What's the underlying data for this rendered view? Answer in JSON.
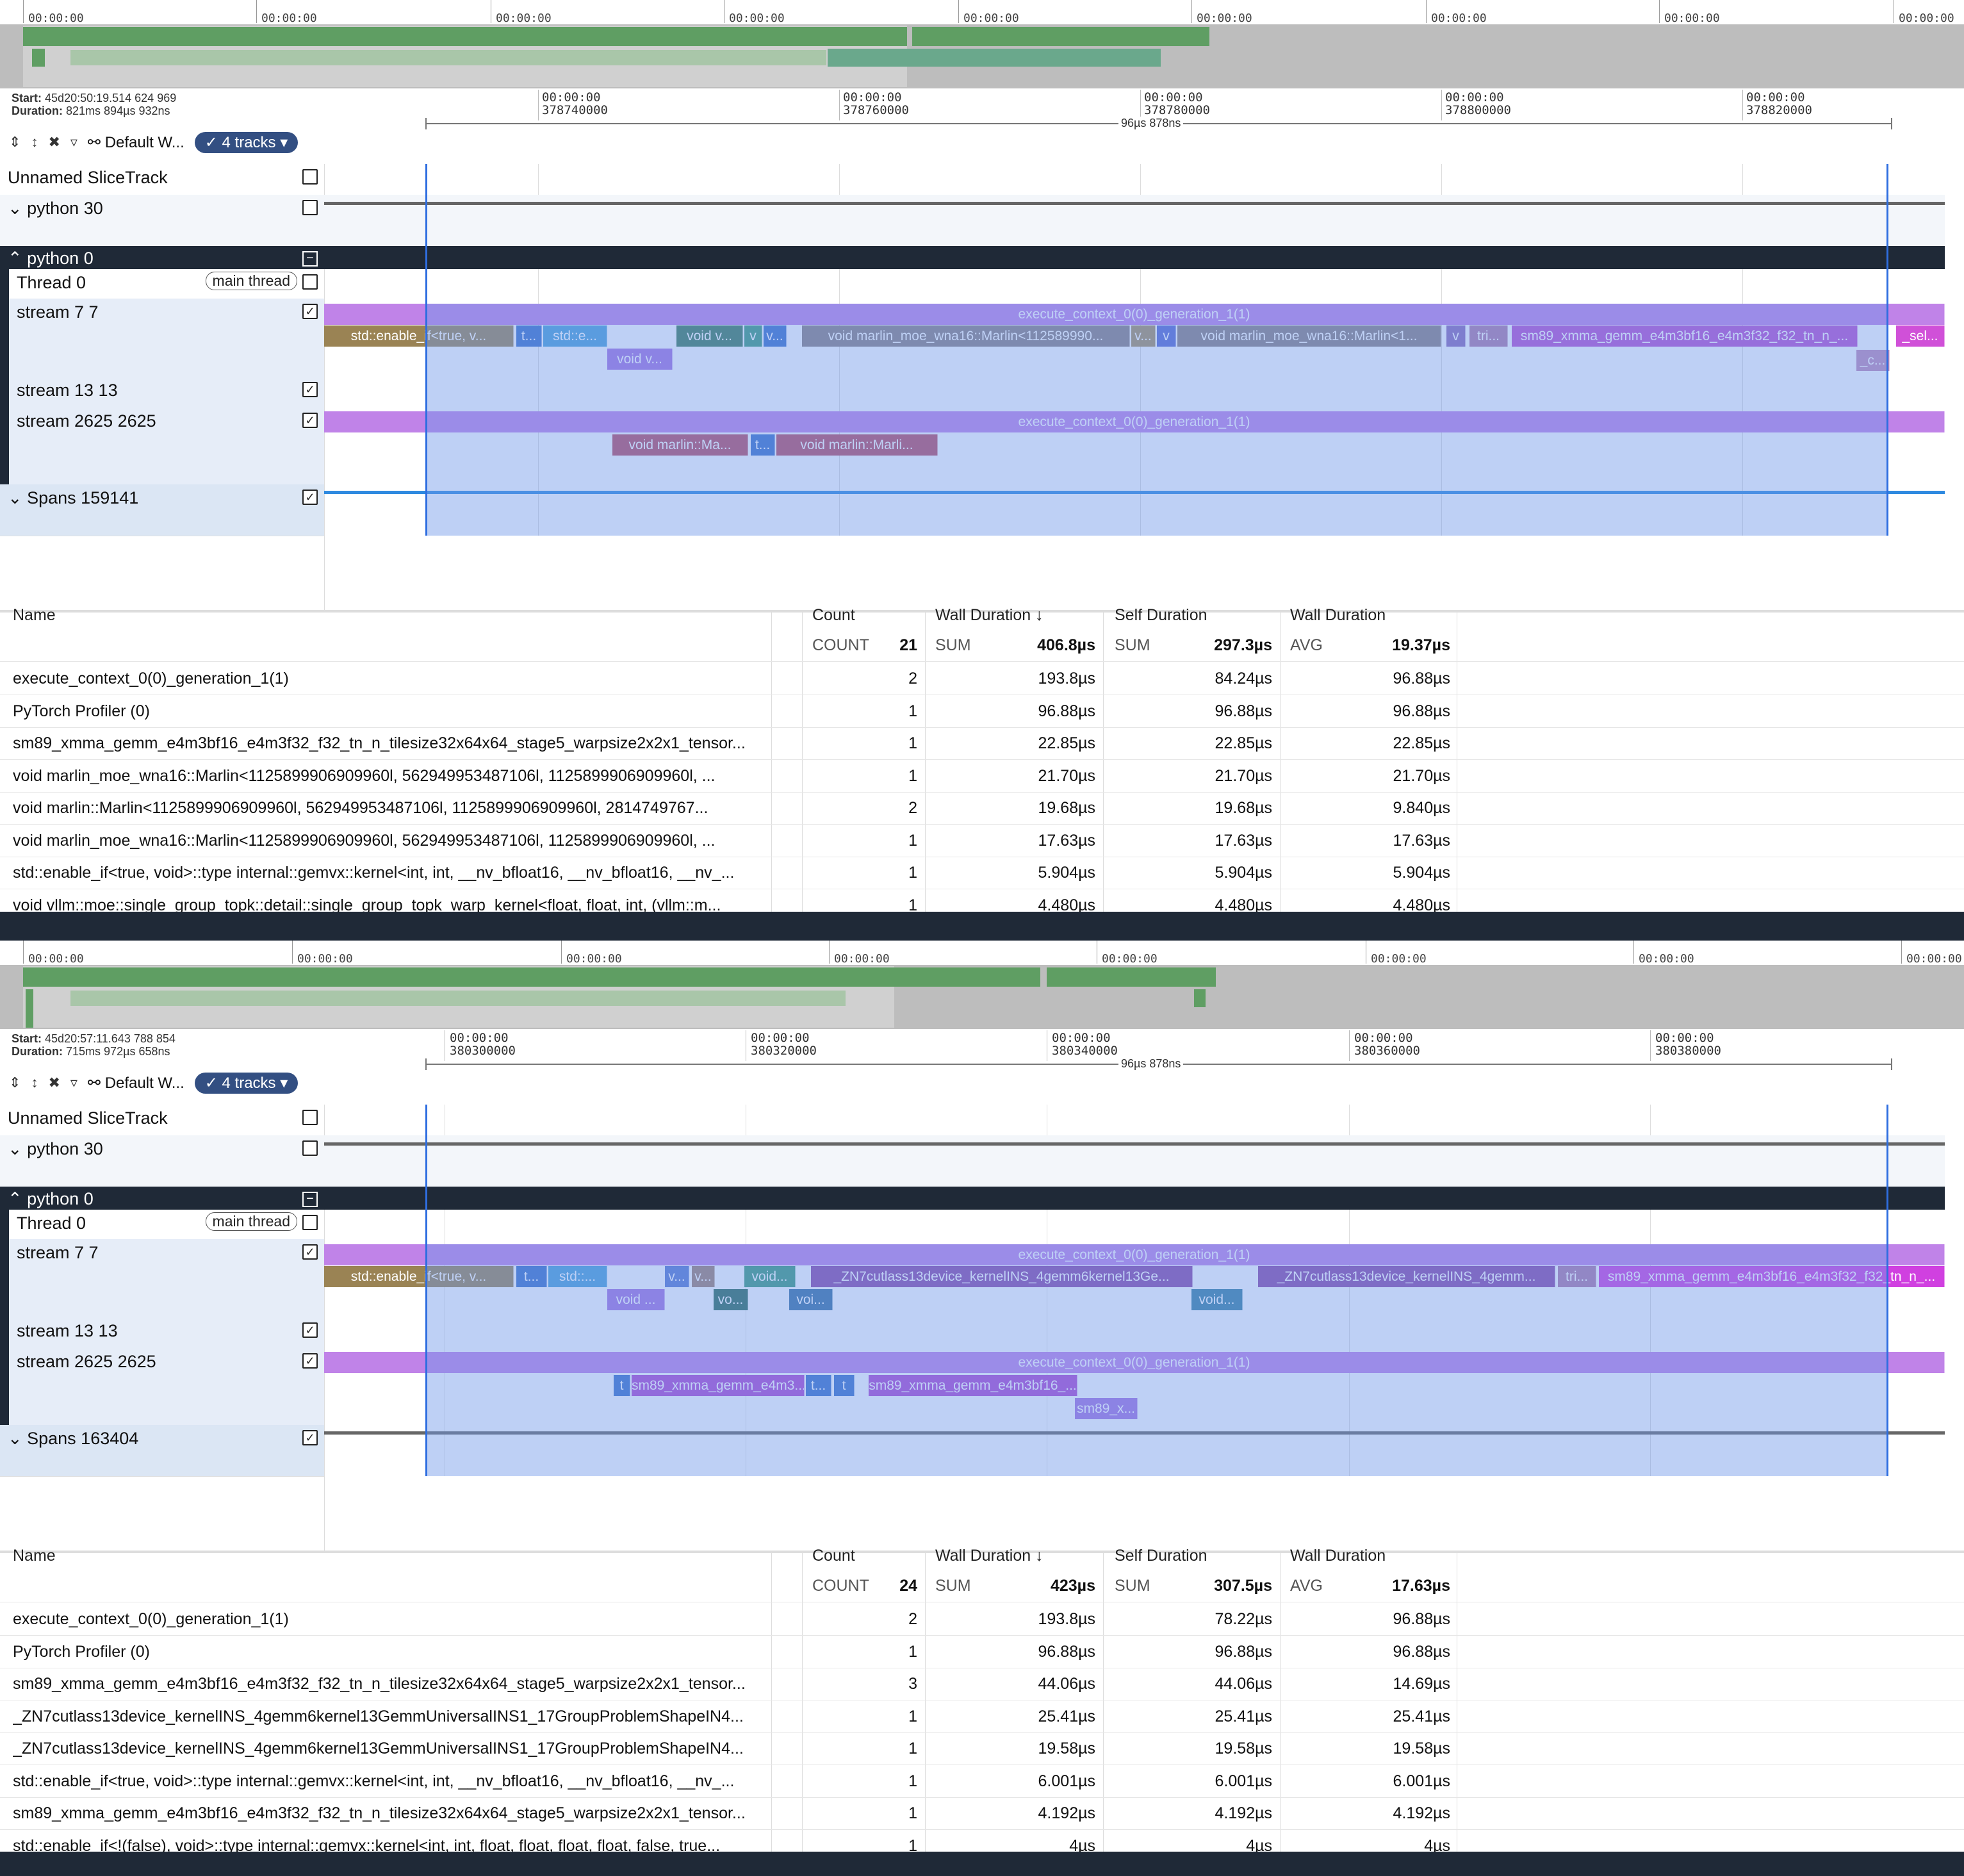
{
  "colors": {
    "accent": "#334f82",
    "selection": "#2f6ee0",
    "group_header": "#1f2937",
    "overview_bar": "#5f9e63"
  },
  "panels": [
    {
      "overview_times": [
        "00:00:00",
        "00:00:00",
        "00:00:00",
        "00:00:00",
        "00:00:00",
        "00:00:00",
        "00:00:00",
        "00:00:00",
        "00:00:00"
      ],
      "start": "45d20:50:19.514 624 969",
      "duration": "821ms 894µs 932ns",
      "start_label": "Start:",
      "duration_label": "Duration:",
      "workspace": "Default W...",
      "tracks_pill": "4 tracks",
      "ruler_labels": [
        [
          "00:00:00",
          "378740000"
        ],
        [
          "00:00:00",
          "378760000"
        ],
        [
          "00:00:00",
          "378780000"
        ],
        [
          "00:00:00",
          "378800000"
        ],
        [
          "00:00:00",
          "378820000"
        ]
      ],
      "span_label": "96µs 878ns",
      "tracks": {
        "unnamed": "Unnamed SliceTrack",
        "python30": "python 30",
        "python0": "python 0",
        "thread0": "Thread 0",
        "main_thread": "main thread",
        "stream7": "stream 7 7",
        "stream13": "stream 13 13",
        "stream2625": "stream 2625 2625",
        "spans": "Spans 159141"
      },
      "slices_s7_top": "execute_context_0(0)_generation_1(1)",
      "slices_s7": [
        "std::enable_if<true, v...",
        "t...",
        "std::e...",
        "void v...",
        "v",
        "v...",
        "void marlin_moe_wna16::Marlin<112589990...",
        "v...",
        "v",
        "void marlin_moe_wna16::Marlin<1...",
        "v",
        "tri...",
        "sm89_xmma_gemm_e4m3bf16_e4m3f32_f32_tn_n_...",
        "_sel..."
      ],
      "slices_s7_row3": [
        "void v...",
        "_c..."
      ],
      "slices_s2625_top": "execute_context_0(0)_generation_1(1)",
      "slices_s2625": [
        "void marlin::Ma...",
        "t...",
        "void marlin::Marli..."
      ],
      "table": {
        "headers": [
          "Name",
          "Count",
          "Wall Duration",
          "Self Duration",
          "Wall Duration"
        ],
        "sort_icon": "↓",
        "agg": {
          "count_label": "COUNT",
          "count": "21",
          "sum_label": "SUM",
          "wall_sum": "406.8µs",
          "sum2_label": "SUM",
          "self_sum": "297.3µs",
          "avg_label": "AVG",
          "avg": "19.37µs"
        },
        "rows": [
          [
            "execute_context_0(0)_generation_1(1)",
            "2",
            "193.8µs",
            "84.24µs",
            "96.88µs"
          ],
          [
            "PyTorch Profiler (0)",
            "1",
            "96.88µs",
            "96.88µs",
            "96.88µs"
          ],
          [
            "sm89_xmma_gemm_e4m3bf16_e4m3f32_f32_tn_n_tilesize32x64x64_stage5_warpsize2x2x1_tensor...",
            "1",
            "22.85µs",
            "22.85µs",
            "22.85µs"
          ],
          [
            "void marlin_moe_wna16::Marlin<1125899906909960l, 562949953487106l, 1125899906909960l, ...",
            "1",
            "21.70µs",
            "21.70µs",
            "21.70µs"
          ],
          [
            "void marlin::Marlin<1125899906909960l, 562949953487106l, 1125899906909960l, 2814749767...",
            "2",
            "19.68µs",
            "19.68µs",
            "9.840µs"
          ],
          [
            "void marlin_moe_wna16::Marlin<1125899906909960l, 562949953487106l, 1125899906909960l, ...",
            "1",
            "17.63µs",
            "17.63µs",
            "17.63µs"
          ],
          [
            "std::enable_if<true, void>::type internal::gemvx::kernel<int, int, __nv_bfloat16, __nv_bfloat16, __nv_...",
            "1",
            "5.904µs",
            "5.904µs",
            "5.904µs"
          ],
          [
            "void vllm::moe::single_group_topk::detail::single_group_topk_warp_kernel<float, float, int, (vllm::m...",
            "1",
            "4.480µs",
            "4.480µs",
            "4.480µs"
          ]
        ]
      }
    },
    {
      "overview_times": [
        "00:00:00",
        "00:00:00",
        "00:00:00",
        "00:00:00",
        "00:00:00",
        "00:00:00",
        "00:00:00",
        "00:00:00"
      ],
      "start": "45d20:57:11.643 788 854",
      "duration": "715ms 972µs 658ns",
      "start_label": "Start:",
      "duration_label": "Duration:",
      "workspace": "Default W...",
      "tracks_pill": "4 tracks",
      "ruler_labels": [
        [
          "00:00:00",
          "380300000"
        ],
        [
          "00:00:00",
          "380320000"
        ],
        [
          "00:00:00",
          "380340000"
        ],
        [
          "00:00:00",
          "380360000"
        ],
        [
          "00:00:00",
          "380380000"
        ]
      ],
      "span_label": "96µs 878ns",
      "tracks": {
        "unnamed": "Unnamed SliceTrack",
        "python30": "python 30",
        "python0": "python 0",
        "thread0": "Thread 0",
        "main_thread": "main thread",
        "stream7": "stream 7 7",
        "stream13": "stream 13 13",
        "stream2625": "stream 2625 2625",
        "spans": "Spans 163404"
      },
      "slices_s7_top": "execute_context_0(0)_generation_1(1)",
      "slices_s7": [
        "std::enable_if<true, v...",
        "t...",
        "std::...",
        "v...",
        "v...",
        "void...",
        "_ZN7cutlass13device_kernelINS_4gemm6kernel13Ge...",
        "_ZN7cutlass13device_kernelINS_4gemm...",
        "tri...",
        "sm89_xmma_gemm_e4m3bf16_e4m3f32_f32_tn_n_..."
      ],
      "slices_s7_row3": [
        "void ...",
        "vo...",
        "voi...",
        "void..."
      ],
      "slices_s2625_top": "execute_context_0(0)_generation_1(1)",
      "slices_s2625": [
        "t",
        "sm89_xmma_gemm_e4m3...",
        "t...",
        "t",
        "sm89_xmma_gemm_e4m3bf16_..."
      ],
      "slices_s2625_row3": [
        "sm89_x..."
      ],
      "table": {
        "headers": [
          "Name",
          "Count",
          "Wall Duration",
          "Self Duration",
          "Wall Duration"
        ],
        "sort_icon": "↓",
        "agg": {
          "count_label": "COUNT",
          "count": "24",
          "sum_label": "SUM",
          "wall_sum": "423µs",
          "sum2_label": "SUM",
          "self_sum": "307.5µs",
          "avg_label": "AVG",
          "avg": "17.63µs"
        },
        "rows": [
          [
            "execute_context_0(0)_generation_1(1)",
            "2",
            "193.8µs",
            "78.22µs",
            "96.88µs"
          ],
          [
            "PyTorch Profiler (0)",
            "1",
            "96.88µs",
            "96.88µs",
            "96.88µs"
          ],
          [
            "sm89_xmma_gemm_e4m3bf16_e4m3f32_f32_tn_n_tilesize32x64x64_stage5_warpsize2x2x1_tensor...",
            "3",
            "44.06µs",
            "44.06µs",
            "14.69µs"
          ],
          [
            "_ZN7cutlass13device_kernelINS_4gemm6kernel13GemmUniversalINS1_17GroupProblemShapeIN4...",
            "1",
            "25.41µs",
            "25.41µs",
            "25.41µs"
          ],
          [
            "_ZN7cutlass13device_kernelINS_4gemm6kernel13GemmUniversalINS1_17GroupProblemShapeIN4...",
            "1",
            "19.58µs",
            "19.58µs",
            "19.58µs"
          ],
          [
            "std::enable_if<true, void>::type internal::gemvx::kernel<int, int, __nv_bfloat16, __nv_bfloat16, __nv_...",
            "1",
            "6.001µs",
            "6.001µs",
            "6.001µs"
          ],
          [
            "sm89_xmma_gemm_e4m3bf16_e4m3f32_f32_tn_n_tilesize32x64x64_stage5_warpsize2x2x1_tensor...",
            "1",
            "4.192µs",
            "4.192µs",
            "4.192µs"
          ],
          [
            "std::enable_if<!(false), void>::type internal::gemvx::kernel<int, int, float, float, float, float, false, true...",
            "1",
            "4µs",
            "4µs",
            "4µs"
          ]
        ]
      }
    }
  ]
}
